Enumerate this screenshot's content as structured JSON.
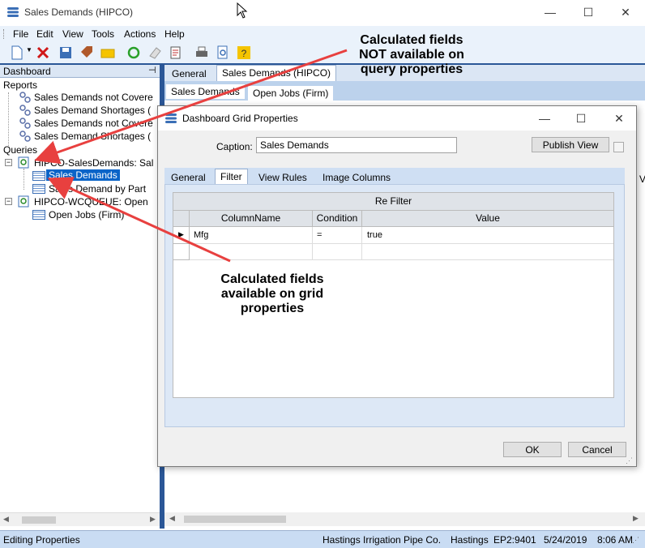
{
  "window": {
    "title": "Sales Demands (HIPCO)",
    "minimize_glyph": "—",
    "maximize_glyph": "☐",
    "close_glyph": "✕"
  },
  "menu": [
    "File",
    "Edit",
    "View",
    "Tools",
    "Actions",
    "Help"
  ],
  "dashboard": {
    "header": "Dashboard",
    "pin_glyph": "⊣",
    "reports_label": "Reports",
    "reports": [
      "Sales Demands not Covere",
      "Sales Demand Shortages (",
      "Sales Demands not Covere",
      "Sales Demand Shortages ("
    ],
    "queries_label": "Queries",
    "queries": [
      {
        "label": "HIPCO-SalesDemands: Sal",
        "children": [
          "Sales Demands",
          "Sales Demand by Part"
        ]
      },
      {
        "label": "HIPCO-WCQUEUE: Open",
        "children": [
          "Open Jobs (Firm)"
        ]
      }
    ]
  },
  "right": {
    "tabs": [
      "General",
      "Sales Demands (HIPCO)"
    ],
    "inner_tabs": [
      "Sales Demands",
      "Open Jobs (Firm)"
    ],
    "clipped_text": "Va"
  },
  "dialog": {
    "title": "Dashboard Grid Properties",
    "caption_label": "Caption:",
    "caption_value": "Sales Demands",
    "publish_label": "Publish View",
    "tabs": [
      "General",
      "Filter",
      "View Rules",
      "Image Columns"
    ],
    "grid_title": "Re Filter",
    "columns": [
      "ColumnName",
      "Condition",
      "Value"
    ],
    "rows": [
      {
        "column": "Mfg",
        "condition": "=",
        "value": "true"
      }
    ],
    "ok_label": "OK",
    "cancel_label": "Cancel"
  },
  "annotations": {
    "top": [
      "Calculated fields",
      "NOT available on",
      "query properties"
    ],
    "bottom": [
      "Calculated fields",
      "available on grid",
      "properties"
    ]
  },
  "status": {
    "left": "Editing Properties",
    "company": "Hastings Irrigation Pipe Co.",
    "city": "Hastings",
    "server": "EP2:9401",
    "date": "5/24/2019",
    "time": "8:06 AM"
  },
  "colors": {
    "accent": "#2b5797",
    "selection": "#0a64c8",
    "arrow": "#e8403f"
  }
}
